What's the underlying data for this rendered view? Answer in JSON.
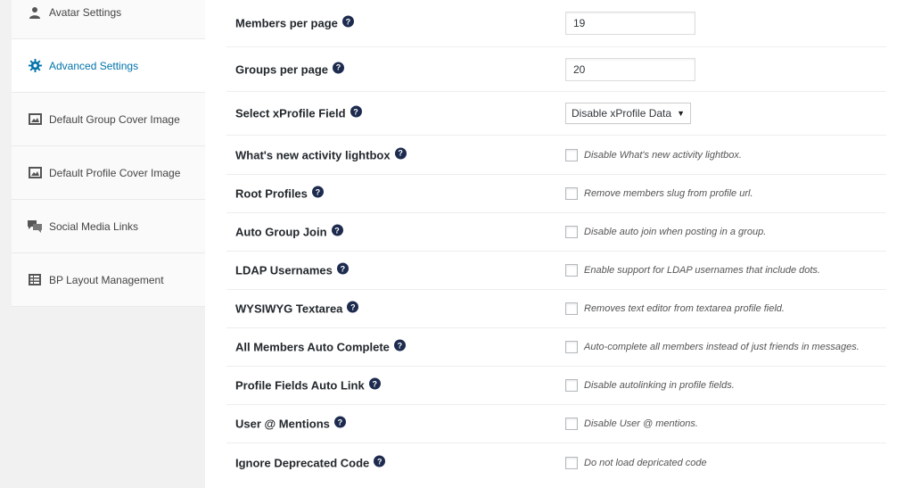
{
  "sidebar": {
    "items": [
      {
        "label": "Avatar Settings",
        "icon": "user-icon",
        "active": false
      },
      {
        "label": "Advanced Settings",
        "icon": "gear-icon",
        "active": true
      },
      {
        "label": "Default Group Cover Image",
        "icon": "image-icon",
        "active": false
      },
      {
        "label": "Default Profile Cover Image",
        "icon": "image-icon",
        "active": false
      },
      {
        "label": "Social Media Links",
        "icon": "chat-icon",
        "active": false
      },
      {
        "label": "BP Layout Management",
        "icon": "layout-icon",
        "active": false
      }
    ]
  },
  "settings": {
    "members_per_page": {
      "label": "Members per page",
      "value": "19"
    },
    "groups_per_page": {
      "label": "Groups per page",
      "value": "20"
    },
    "xprofile_field": {
      "label": "Select xProfile Field",
      "value": "Disable xProfile Data"
    },
    "checkboxes": [
      {
        "label": "What's new activity lightbox",
        "desc": "Disable What's new activity lightbox.",
        "checked": false
      },
      {
        "label": "Root Profiles",
        "desc": "Remove members slug from profile url.",
        "checked": false
      },
      {
        "label": "Auto Group Join",
        "desc": "Disable auto join when posting in a group.",
        "checked": false
      },
      {
        "label": "LDAP Usernames",
        "desc": "Enable support for LDAP usernames that include dots.",
        "checked": false
      },
      {
        "label": "WYSIWYG Textarea",
        "desc": "Removes text editor from textarea profile field.",
        "checked": false
      },
      {
        "label": "All Members Auto Complete",
        "desc": "Auto-complete all members instead of just friends in messages.",
        "checked": false
      },
      {
        "label": "Profile Fields Auto Link",
        "desc": "Disable autolinking in profile fields.",
        "checked": false
      },
      {
        "label": "User @ Mentions",
        "desc": "Disable User @ mentions.",
        "checked": false
      },
      {
        "label": "Ignore Deprecated Code",
        "desc": "Do not load depricated code",
        "checked": false
      }
    ]
  },
  "help_glyph": "?",
  "colors": {
    "accent": "#0073aa",
    "help_bg": "#1d2b4f"
  }
}
